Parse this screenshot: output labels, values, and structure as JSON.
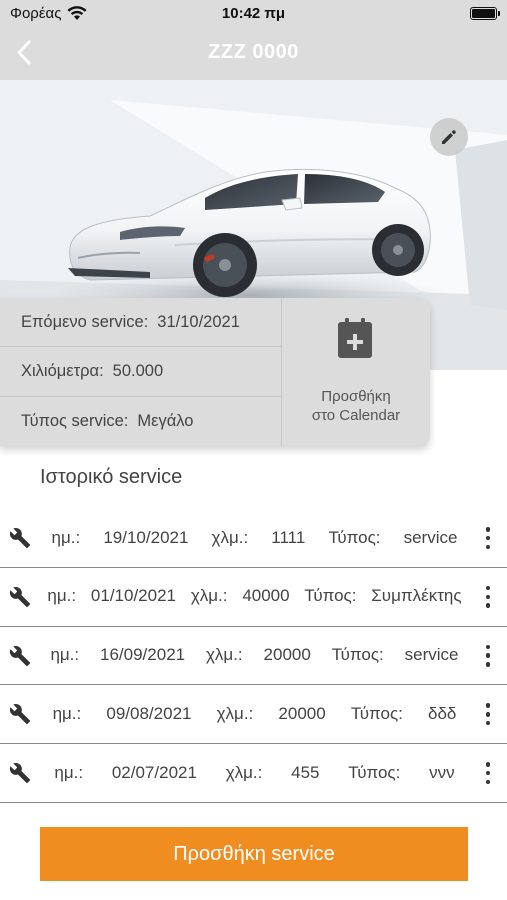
{
  "status_bar": {
    "carrier": "Φορέας",
    "time": "10:42 πμ"
  },
  "nav": {
    "title": "ZZZ 0000",
    "back_icon": "chevron-left-icon"
  },
  "hero": {
    "edit_icon": "pencil-icon"
  },
  "info": {
    "next_service_label": "Επόμενο service:",
    "next_service_value": "31/10/2021",
    "km_label": "Χιλιόμετρα:",
    "km_value": "50.000",
    "type_label": "Τύπος service:",
    "type_value": "Μεγάλο",
    "calendar_icon": "calendar-plus-icon",
    "calendar_label_line1": "Προσθήκη",
    "calendar_label_line2": "στο Calendar"
  },
  "history": {
    "title": "Ιστορικό service",
    "date_label": "ημ.:",
    "km_label": "χλμ.:",
    "type_label": "Τύπος:",
    "rows": [
      {
        "date": "19/10/2021",
        "km": "1111",
        "type": "service"
      },
      {
        "date": "01/10/2021",
        "km": "40000",
        "type": "Συμπλέκτης"
      },
      {
        "date": "16/09/2021",
        "km": "20000",
        "type": "service"
      },
      {
        "date": "09/08/2021",
        "km": "20000",
        "type": "δδδ"
      },
      {
        "date": "02/07/2021",
        "km": "455",
        "type": "ννν"
      }
    ]
  },
  "add_button": {
    "label": "Προσθήκη service"
  },
  "colors": {
    "bar_gray": "#dcdcdc",
    "accent_orange": "#ef8d21",
    "text": "#444444"
  }
}
